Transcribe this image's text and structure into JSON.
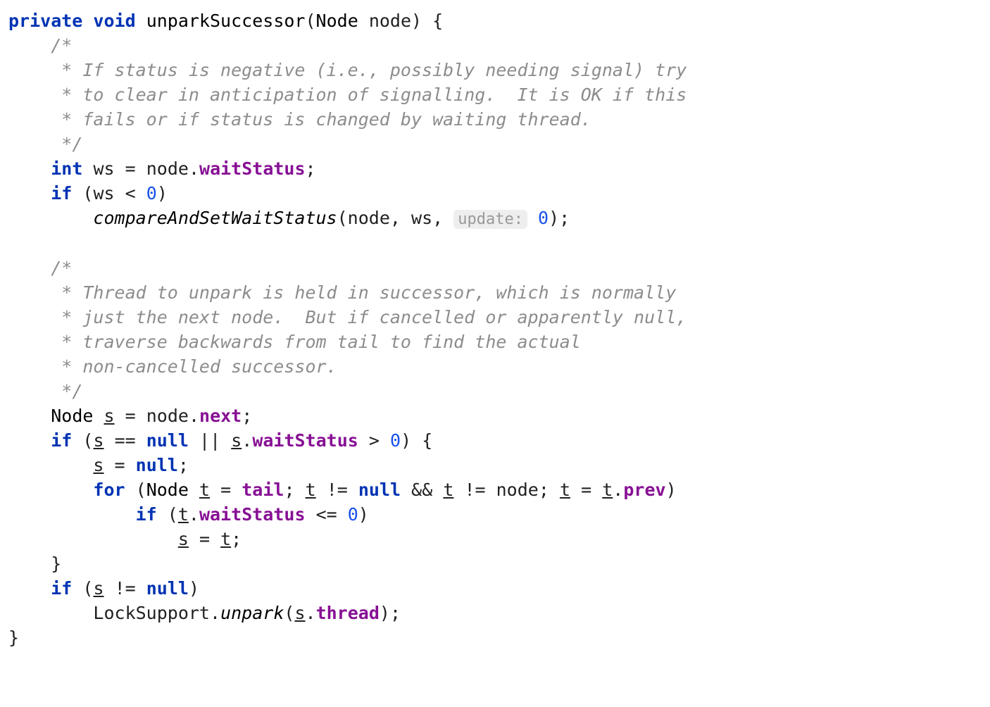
{
  "tokens": {
    "private": "private",
    "void": "void",
    "unparkSuccessor": "unparkSuccessor",
    "Node": "Node",
    "node": "node",
    "obrace": "{",
    "cbrace": "}",
    "oparen": "(",
    "cparen": ")",
    "semi": ";",
    "comment1_open": "/*",
    "comment1_l1": " * If status is negative (i.e., possibly needing signal) try",
    "comment1_l2": " * to clear in anticipation of signalling.  It is OK if this",
    "comment1_l3": " * fails or if status is changed by waiting thread.",
    "comment1_close": " */",
    "int": "int",
    "ws": "ws",
    "eq": "=",
    "dot": ".",
    "waitStatus": "waitStatus",
    "if": "if",
    "lt": "<",
    "zero": "0",
    "compareAndSetWaitStatus": "compareAndSetWaitStatus",
    "comma": ",",
    "update_hint": "update:",
    "comment2_open": "/*",
    "comment2_l1": " * Thread to unpark is held in successor, which is normally",
    "comment2_l2": " * just the next node.  But if cancelled or apparently null,",
    "comment2_l3": " * traverse backwards from tail to find the actual",
    "comment2_l4": " * non-cancelled successor.",
    "comment2_close": " */",
    "s": "s",
    "next": "next",
    "eqeq": "==",
    "null": "null",
    "oror": "||",
    "gt": ">",
    "for": "for",
    "t": "t",
    "tail": "tail",
    "neq": "!=",
    "andand": "&&",
    "prev": "prev",
    "lteq": "<=",
    "LockSupport": "LockSupport",
    "unpark": "unpark",
    "thread": "thread"
  }
}
